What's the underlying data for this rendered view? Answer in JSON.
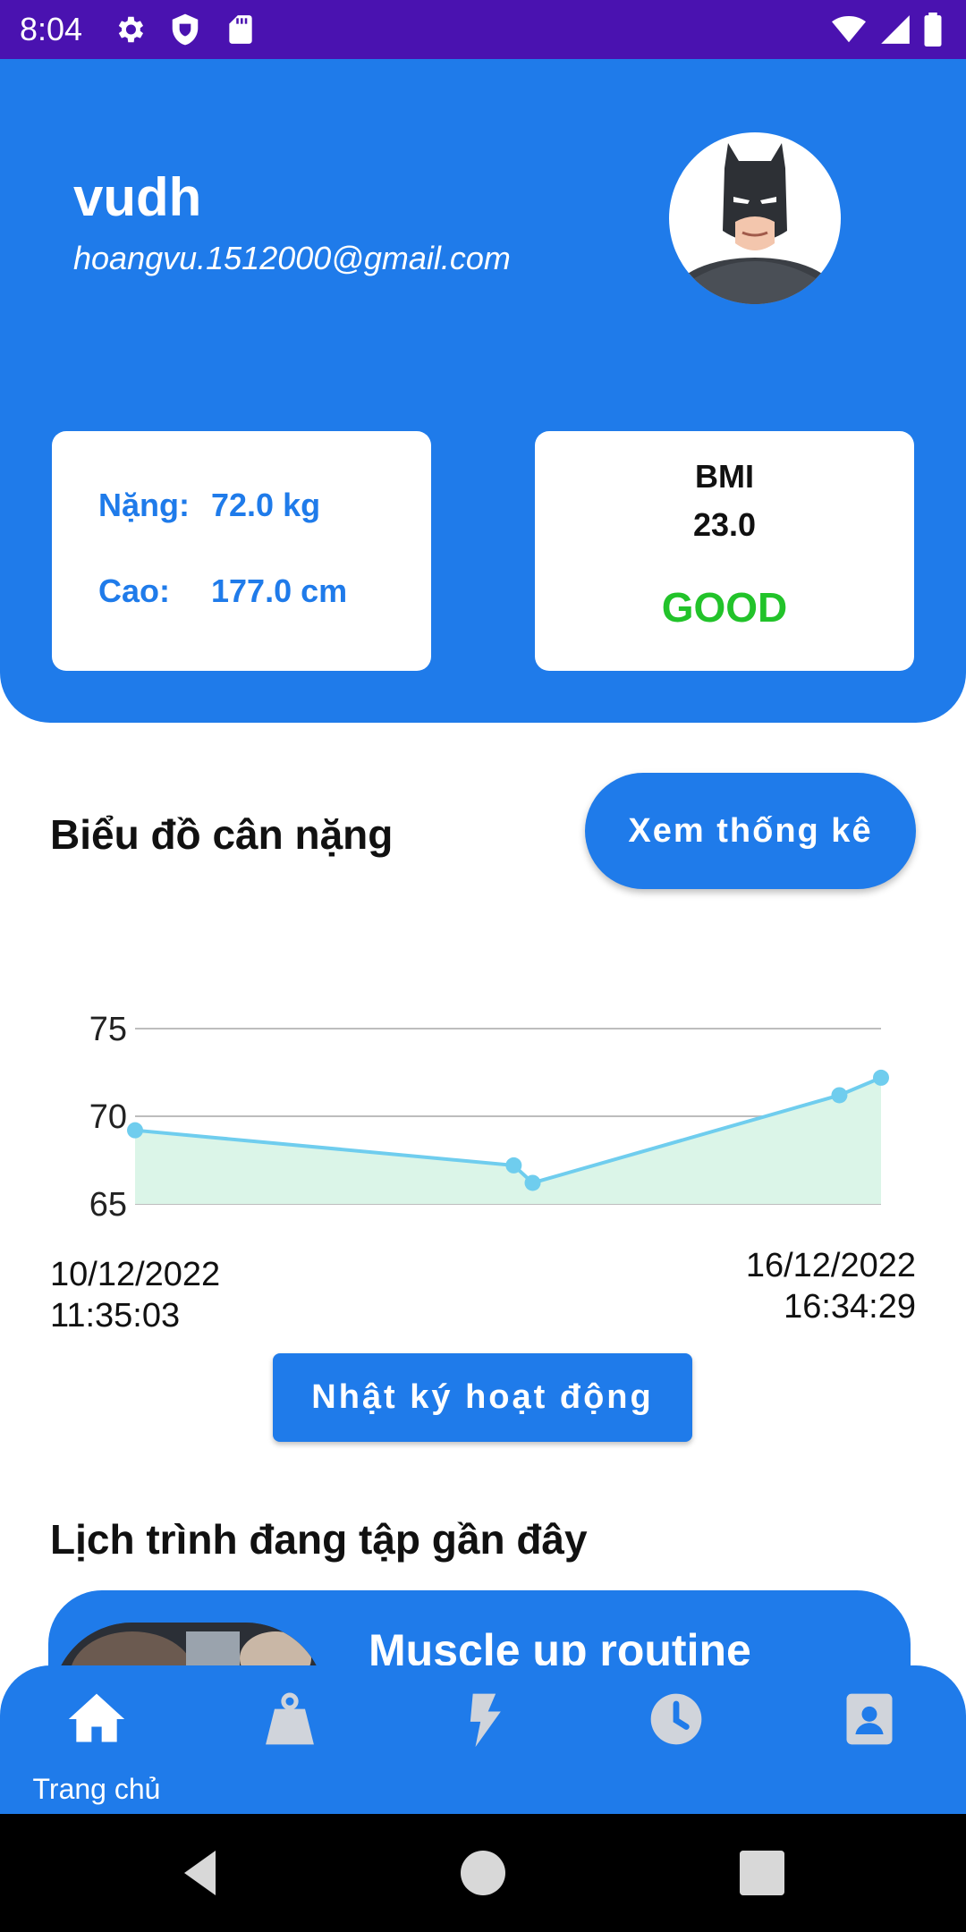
{
  "status_bar": {
    "time": "8:04",
    "left_icons": [
      "settings-icon",
      "shield-icon",
      "sd-card-icon"
    ],
    "right_icons": [
      "wifi-icon",
      "signal-icon",
      "battery-icon"
    ],
    "background": "#4a12b0"
  },
  "profile": {
    "name": "vudh",
    "email": "hoangvu.1512000@gmail.com",
    "avatar_icon": "batman-avatar-icon"
  },
  "body_stats": {
    "weight_label": "Nặng:",
    "weight_value": "72.0 kg",
    "height_label": "Cao:",
    "height_value": "177.0 cm"
  },
  "bmi": {
    "title": "BMI",
    "value": "23.0",
    "status": "GOOD",
    "status_color": "#22c32a"
  },
  "weight_section": {
    "title": "Biểu đồ cân nặng",
    "stats_button": "Xem thống kê"
  },
  "chart_data": {
    "type": "area",
    "title": "",
    "xlabel": "",
    "ylabel": "",
    "ylim": [
      65,
      75
    ],
    "yticks": [
      "75",
      "70",
      "65"
    ],
    "x_first_label": [
      "10/12/2022",
      "11:35:03"
    ],
    "x_last_label": [
      "16/12/2022",
      "16:34:29"
    ],
    "x": [
      0,
      1.0,
      1.05,
      1.86,
      1.97
    ],
    "values": [
      69.2,
      67.2,
      66.2,
      71.2,
      72.2
    ],
    "line_color": "#6fcdee",
    "fill_color": "#dbf5e8",
    "grid": true
  },
  "activity_button": "Nhật ký hoạt động",
  "recent_section": {
    "title": "Lịch trình đang tập gần đây",
    "routine_title": "Muscle up routine"
  },
  "bottom_nav": {
    "items": [
      {
        "icon": "home-icon",
        "label": "Trang chủ",
        "active": true
      },
      {
        "icon": "weight-icon",
        "label": ""
      },
      {
        "icon": "lightning-icon",
        "label": ""
      },
      {
        "icon": "clock-icon",
        "label": ""
      },
      {
        "icon": "contact-icon",
        "label": ""
      }
    ]
  },
  "colors": {
    "primary": "#1f7bea",
    "white": "#ffffff"
  }
}
